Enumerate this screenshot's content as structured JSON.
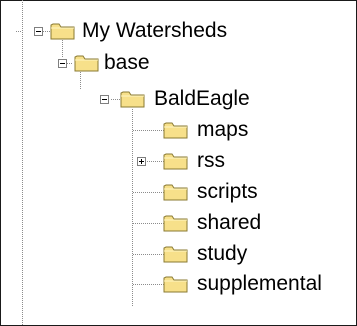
{
  "tree": {
    "nodes": [
      {
        "label": "My Watersheds",
        "icon": "folder-icon",
        "expanded": true
      },
      {
        "label": "base",
        "icon": "folder-icon",
        "expanded": true
      },
      {
        "label": "BaldEagle",
        "icon": "folder-icon",
        "expanded": true
      },
      {
        "label": "maps",
        "icon": "folder-icon"
      },
      {
        "label": "rss",
        "icon": "folder-icon",
        "expanded": false
      },
      {
        "label": "scripts",
        "icon": "folder-icon"
      },
      {
        "label": "shared",
        "icon": "folder-icon"
      },
      {
        "label": "study",
        "icon": "folder-icon"
      },
      {
        "label": "supplemental",
        "icon": "folder-icon"
      }
    ]
  },
  "colors": {
    "folder_fill": "#f7e08a",
    "folder_edge": "#8a7a32",
    "line": "#8c8c8c"
  }
}
